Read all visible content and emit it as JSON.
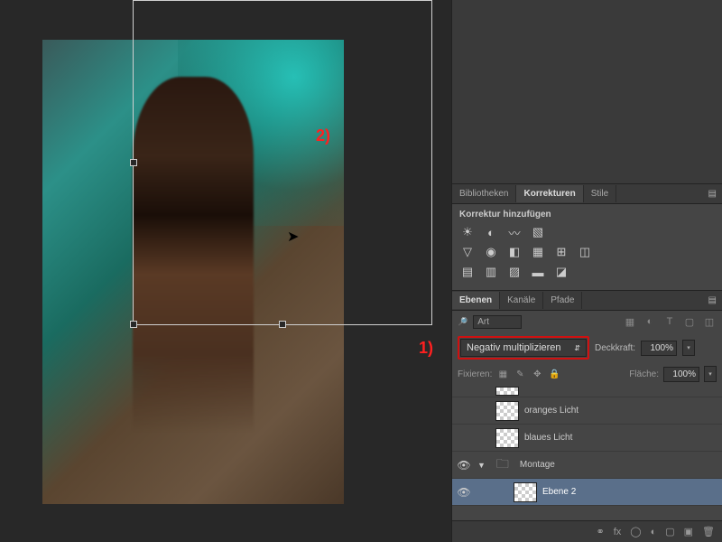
{
  "annotations": {
    "one": "1)",
    "two": "2)"
  },
  "tabs_upper": {
    "bibliotheken": "Bibliotheken",
    "korrekturen": "Korrekturen",
    "stile": "Stile"
  },
  "adjustments": {
    "heading": "Korrektur hinzufügen"
  },
  "tabs_layers": {
    "ebenen": "Ebenen",
    "kanaele": "Kanäle",
    "pfade": "Pfade"
  },
  "kind_filter": "Art",
  "blend_mode": "Negativ multiplizieren",
  "opacity_label": "Deckkraft:",
  "opacity_value": "100%",
  "fill_label": "Fläche:",
  "fill_value": "100%",
  "lock_label": "Fixieren:",
  "layers": [
    {
      "visible": false,
      "name": "oranges Licht",
      "thumb": "checker",
      "indent": 1
    },
    {
      "visible": false,
      "name": "blaues Licht",
      "thumb": "checker",
      "indent": 1
    },
    {
      "visible": true,
      "name": "Montage",
      "thumb": "folder",
      "indent": 0,
      "group": true
    },
    {
      "visible": true,
      "name": "Ebene 2",
      "thumb": "checker",
      "indent": 2,
      "selected": true
    }
  ],
  "icons": {
    "brightness": "☀",
    "levels": "◐",
    "curves": "〰",
    "exposure": "▧",
    "vibrance": "▽",
    "hue": "◉",
    "bw": "◧",
    "photo": "▦",
    "mixer": "⊞",
    "lut": "◫",
    "invert": "▤",
    "poster": "▥",
    "thresh": "▨",
    "grad": "▬",
    "sel": "◪"
  },
  "bottom": {
    "link": "⚭",
    "fx": "fx",
    "mask": "◯",
    "adj": "◐",
    "group": "▢",
    "new": "▣",
    "trash": "🗑"
  }
}
